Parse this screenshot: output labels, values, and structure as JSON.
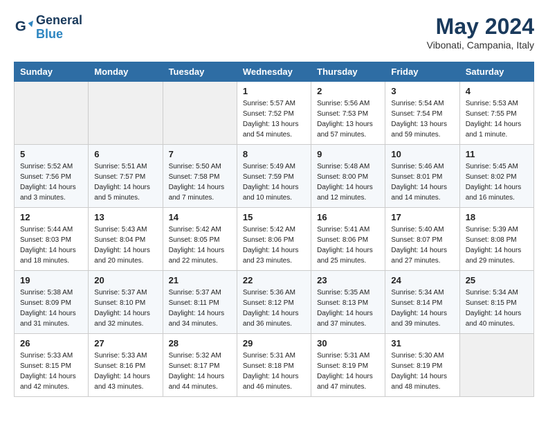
{
  "header": {
    "logo_line1": "General",
    "logo_line2": "Blue",
    "month_title": "May 2024",
    "subtitle": "Vibonati, Campania, Italy"
  },
  "weekdays": [
    "Sunday",
    "Monday",
    "Tuesday",
    "Wednesday",
    "Thursday",
    "Friday",
    "Saturday"
  ],
  "weeks": [
    [
      {
        "day": "",
        "info": ""
      },
      {
        "day": "",
        "info": ""
      },
      {
        "day": "",
        "info": ""
      },
      {
        "day": "1",
        "info": "Sunrise: 5:57 AM\nSunset: 7:52 PM\nDaylight: 13 hours\nand 54 minutes."
      },
      {
        "day": "2",
        "info": "Sunrise: 5:56 AM\nSunset: 7:53 PM\nDaylight: 13 hours\nand 57 minutes."
      },
      {
        "day": "3",
        "info": "Sunrise: 5:54 AM\nSunset: 7:54 PM\nDaylight: 13 hours\nand 59 minutes."
      },
      {
        "day": "4",
        "info": "Sunrise: 5:53 AM\nSunset: 7:55 PM\nDaylight: 14 hours\nand 1 minute."
      }
    ],
    [
      {
        "day": "5",
        "info": "Sunrise: 5:52 AM\nSunset: 7:56 PM\nDaylight: 14 hours\nand 3 minutes."
      },
      {
        "day": "6",
        "info": "Sunrise: 5:51 AM\nSunset: 7:57 PM\nDaylight: 14 hours\nand 5 minutes."
      },
      {
        "day": "7",
        "info": "Sunrise: 5:50 AM\nSunset: 7:58 PM\nDaylight: 14 hours\nand 7 minutes."
      },
      {
        "day": "8",
        "info": "Sunrise: 5:49 AM\nSunset: 7:59 PM\nDaylight: 14 hours\nand 10 minutes."
      },
      {
        "day": "9",
        "info": "Sunrise: 5:48 AM\nSunset: 8:00 PM\nDaylight: 14 hours\nand 12 minutes."
      },
      {
        "day": "10",
        "info": "Sunrise: 5:46 AM\nSunset: 8:01 PM\nDaylight: 14 hours\nand 14 minutes."
      },
      {
        "day": "11",
        "info": "Sunrise: 5:45 AM\nSunset: 8:02 PM\nDaylight: 14 hours\nand 16 minutes."
      }
    ],
    [
      {
        "day": "12",
        "info": "Sunrise: 5:44 AM\nSunset: 8:03 PM\nDaylight: 14 hours\nand 18 minutes."
      },
      {
        "day": "13",
        "info": "Sunrise: 5:43 AM\nSunset: 8:04 PM\nDaylight: 14 hours\nand 20 minutes."
      },
      {
        "day": "14",
        "info": "Sunrise: 5:42 AM\nSunset: 8:05 PM\nDaylight: 14 hours\nand 22 minutes."
      },
      {
        "day": "15",
        "info": "Sunrise: 5:42 AM\nSunset: 8:06 PM\nDaylight: 14 hours\nand 23 minutes."
      },
      {
        "day": "16",
        "info": "Sunrise: 5:41 AM\nSunset: 8:06 PM\nDaylight: 14 hours\nand 25 minutes."
      },
      {
        "day": "17",
        "info": "Sunrise: 5:40 AM\nSunset: 8:07 PM\nDaylight: 14 hours\nand 27 minutes."
      },
      {
        "day": "18",
        "info": "Sunrise: 5:39 AM\nSunset: 8:08 PM\nDaylight: 14 hours\nand 29 minutes."
      }
    ],
    [
      {
        "day": "19",
        "info": "Sunrise: 5:38 AM\nSunset: 8:09 PM\nDaylight: 14 hours\nand 31 minutes."
      },
      {
        "day": "20",
        "info": "Sunrise: 5:37 AM\nSunset: 8:10 PM\nDaylight: 14 hours\nand 32 minutes."
      },
      {
        "day": "21",
        "info": "Sunrise: 5:37 AM\nSunset: 8:11 PM\nDaylight: 14 hours\nand 34 minutes."
      },
      {
        "day": "22",
        "info": "Sunrise: 5:36 AM\nSunset: 8:12 PM\nDaylight: 14 hours\nand 36 minutes."
      },
      {
        "day": "23",
        "info": "Sunrise: 5:35 AM\nSunset: 8:13 PM\nDaylight: 14 hours\nand 37 minutes."
      },
      {
        "day": "24",
        "info": "Sunrise: 5:34 AM\nSunset: 8:14 PM\nDaylight: 14 hours\nand 39 minutes."
      },
      {
        "day": "25",
        "info": "Sunrise: 5:34 AM\nSunset: 8:15 PM\nDaylight: 14 hours\nand 40 minutes."
      }
    ],
    [
      {
        "day": "26",
        "info": "Sunrise: 5:33 AM\nSunset: 8:15 PM\nDaylight: 14 hours\nand 42 minutes."
      },
      {
        "day": "27",
        "info": "Sunrise: 5:33 AM\nSunset: 8:16 PM\nDaylight: 14 hours\nand 43 minutes."
      },
      {
        "day": "28",
        "info": "Sunrise: 5:32 AM\nSunset: 8:17 PM\nDaylight: 14 hours\nand 44 minutes."
      },
      {
        "day": "29",
        "info": "Sunrise: 5:31 AM\nSunset: 8:18 PM\nDaylight: 14 hours\nand 46 minutes."
      },
      {
        "day": "30",
        "info": "Sunrise: 5:31 AM\nSunset: 8:19 PM\nDaylight: 14 hours\nand 47 minutes."
      },
      {
        "day": "31",
        "info": "Sunrise: 5:30 AM\nSunset: 8:19 PM\nDaylight: 14 hours\nand 48 minutes."
      },
      {
        "day": "",
        "info": ""
      }
    ]
  ]
}
